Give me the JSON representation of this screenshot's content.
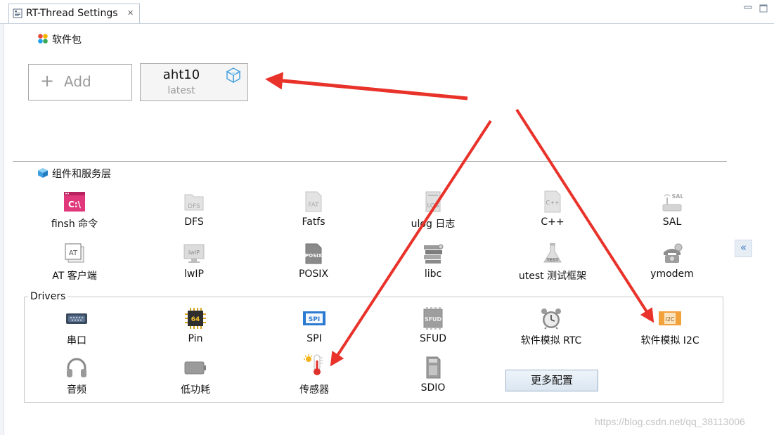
{
  "tab": {
    "title": "RT-Thread Settings",
    "close_icon": "close-icon"
  },
  "colors": {
    "arrow": "#e8322a",
    "accent": "#3d7bbf",
    "icon_blue": "#4aa3df"
  },
  "packages": {
    "title": "软件包",
    "add_label": "Add",
    "items": [
      {
        "name": "aht10",
        "version": "latest"
      }
    ]
  },
  "components": {
    "title": "组件和服务层",
    "items": [
      {
        "label": "finsh 命令",
        "icon": "terminal-icon"
      },
      {
        "label": "DFS",
        "icon": "folder-icon"
      },
      {
        "label": "Fatfs",
        "icon": "fat-file-icon"
      },
      {
        "label": "ulog 日志",
        "icon": "log-icon"
      },
      {
        "label": "C++",
        "icon": "cpp-file-icon"
      },
      {
        "label": "SAL",
        "icon": "router-icon"
      },
      {
        "label": "AT 客户端",
        "icon": "at-icon"
      },
      {
        "label": "lwIP",
        "icon": "monitor-icon"
      },
      {
        "label": "POSIX",
        "icon": "posix-doc-icon"
      },
      {
        "label": "libc",
        "icon": "books-icon"
      },
      {
        "label": "utest 测试框架",
        "icon": "flask-icon"
      },
      {
        "label": "ymodem",
        "icon": "phone-icon"
      }
    ]
  },
  "drivers": {
    "title": "Drivers",
    "items": [
      {
        "label": "串口",
        "icon": "serial-port-icon"
      },
      {
        "label": "Pin",
        "icon": "chip-icon",
        "badge": "64"
      },
      {
        "label": "SPI",
        "icon": "spi-icon",
        "badge": "SPI"
      },
      {
        "label": "SFUD",
        "icon": "flash-icon",
        "badge": "SFUD"
      },
      {
        "label": "软件模拟 RTC",
        "icon": "clock-icon"
      },
      {
        "label": "软件模拟 I2C",
        "icon": "i2c-icon",
        "badge": "I2C"
      },
      {
        "label": "音频",
        "icon": "headphones-icon"
      },
      {
        "label": "低功耗",
        "icon": "battery-icon"
      },
      {
        "label": "传感器",
        "icon": "thermometer-icon"
      },
      {
        "label": "SDIO",
        "icon": "sd-card-icon"
      }
    ],
    "more_label": "更多配置"
  },
  "collapse_label": "«",
  "watermark": "https://blog.csdn.net/qq_38113006"
}
